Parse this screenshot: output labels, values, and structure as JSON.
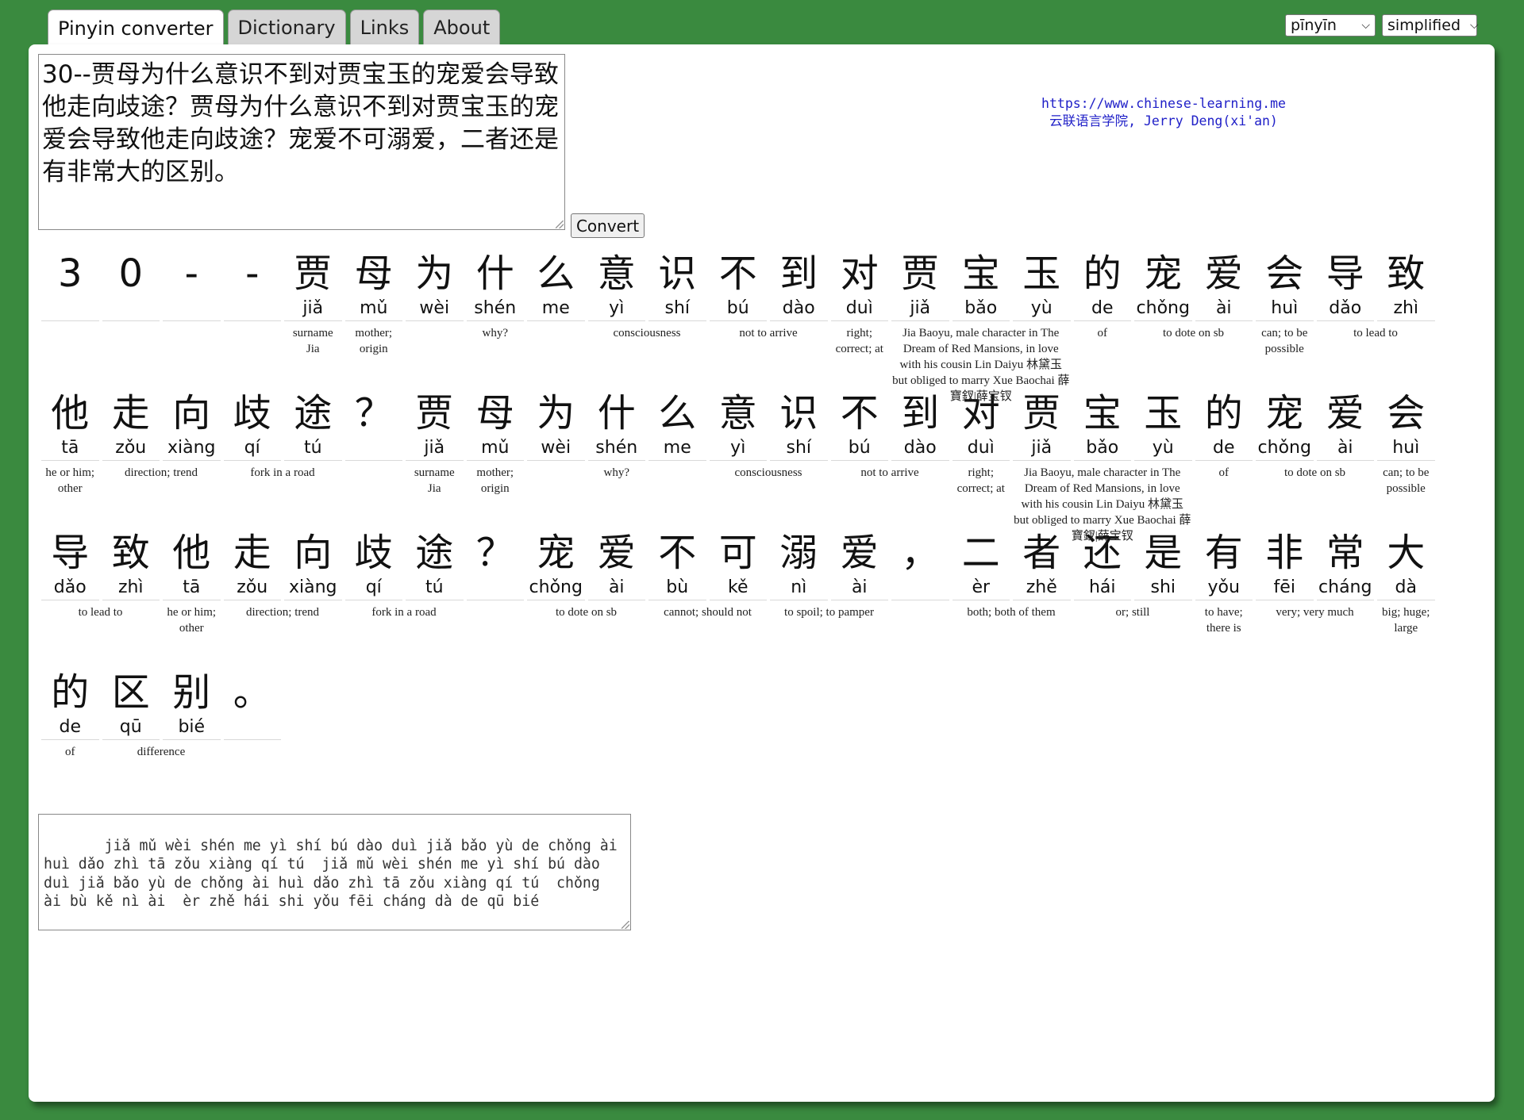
{
  "tabs": [
    "Pinyin converter",
    "Dictionary",
    "Links",
    "About"
  ],
  "selects": {
    "tone_mode": "pīnyīn",
    "script": "simplified"
  },
  "input_text": "30--贾母为什么意识不到对贾宝玉的宠爱会导致他走向歧途？贾母为什么意识不到对贾宝玉的宠爱会导致他走向歧途？宠爱不可溺爱，二者还是有非常大的区别。",
  "convert_label": "Convert",
  "credit": {
    "url": "https://www.chinese-learning.me",
    "line2": "云联语言学院, Jerry Deng(xi'an)"
  },
  "rows": [
    {
      "hanzi": [
        "3",
        "0",
        "-",
        "-",
        "贾",
        "母",
        "为",
        "什",
        "么",
        "意",
        "识",
        "不",
        "到",
        "对",
        "贾",
        "宝",
        "玉",
        "的",
        "宠",
        "爱",
        "会",
        "导",
        "致"
      ],
      "pinyin": [
        "",
        "",
        "",
        "",
        "jiǎ",
        "mǔ",
        "wèi",
        "shén",
        "me",
        "yì",
        "shí",
        "bú",
        "dào",
        "duì",
        "jiǎ",
        "bǎo",
        "yù",
        "de",
        "chǒng",
        "ài",
        "huì",
        "dǎo",
        "zhì"
      ],
      "glosses": [
        {
          "start": 0,
          "span": 1,
          "text": ""
        },
        {
          "start": 1,
          "span": 1,
          "text": ""
        },
        {
          "start": 2,
          "span": 1,
          "text": ""
        },
        {
          "start": 3,
          "span": 1,
          "text": ""
        },
        {
          "start": 4,
          "span": 1,
          "text": "surname Jia"
        },
        {
          "start": 5,
          "span": 1,
          "text": "mother; origin"
        },
        {
          "start": 6,
          "span": 3,
          "text": "why?"
        },
        {
          "start": 9,
          "span": 2,
          "text": "consciousness"
        },
        {
          "start": 11,
          "span": 2,
          "text": "not to arrive"
        },
        {
          "start": 13,
          "span": 1,
          "text": "right; correct; at"
        },
        {
          "start": 14,
          "span": 3,
          "text": "Jia Baoyu, male character in The Dream of Red Mansions, in love with his cousin Lin Daiyu 林黛玉 but obliged to marry Xue Baochai 薛寶釵|薛宝钗"
        },
        {
          "start": 17,
          "span": 1,
          "text": "of"
        },
        {
          "start": 18,
          "span": 2,
          "text": "to dote on sb"
        },
        {
          "start": 20,
          "span": 1,
          "text": "can; to be possible"
        },
        {
          "start": 21,
          "span": 2,
          "text": "to lead to"
        }
      ]
    },
    {
      "hanzi": [
        "他",
        "走",
        "向",
        "歧",
        "途",
        "？",
        "贾",
        "母",
        "为",
        "什",
        "么",
        "意",
        "识",
        "不",
        "到",
        "对",
        "贾",
        "宝",
        "玉",
        "的",
        "宠",
        "爱",
        "会"
      ],
      "pinyin": [
        "tā",
        "zǒu",
        "xiàng",
        "qí",
        "tú",
        "",
        "jiǎ",
        "mǔ",
        "wèi",
        "shén",
        "me",
        "yì",
        "shí",
        "bú",
        "dào",
        "duì",
        "jiǎ",
        "bǎo",
        "yù",
        "de",
        "chǒng",
        "ài",
        "huì"
      ],
      "glosses": [
        {
          "start": 0,
          "span": 1,
          "text": "he or him; other"
        },
        {
          "start": 1,
          "span": 2,
          "text": "direction; trend"
        },
        {
          "start": 3,
          "span": 2,
          "text": "fork in a road"
        },
        {
          "start": 5,
          "span": 1,
          "text": ""
        },
        {
          "start": 6,
          "span": 1,
          "text": "surname Jia"
        },
        {
          "start": 7,
          "span": 1,
          "text": "mother; origin"
        },
        {
          "start": 8,
          "span": 3,
          "text": "why?"
        },
        {
          "start": 11,
          "span": 2,
          "text": "consciousness"
        },
        {
          "start": 13,
          "span": 2,
          "text": "not to arrive"
        },
        {
          "start": 15,
          "span": 1,
          "text": "right; correct; at"
        },
        {
          "start": 16,
          "span": 3,
          "text": "Jia Baoyu, male character in The Dream of Red Mansions, in love with his cousin Lin Daiyu 林黛玉 but obliged to marry Xue Baochai 薛寶釵|薛宝钗"
        },
        {
          "start": 19,
          "span": 1,
          "text": "of"
        },
        {
          "start": 20,
          "span": 2,
          "text": "to dote on sb"
        },
        {
          "start": 22,
          "span": 1,
          "text": "can; to be possible"
        }
      ]
    },
    {
      "hanzi": [
        "导",
        "致",
        "他",
        "走",
        "向",
        "歧",
        "途",
        "？",
        "宠",
        "爱",
        "不",
        "可",
        "溺",
        "爱",
        "，",
        "二",
        "者",
        "还",
        "是",
        "有",
        "非",
        "常",
        "大"
      ],
      "pinyin": [
        "dǎo",
        "zhì",
        "tā",
        "zǒu",
        "xiàng",
        "qí",
        "tú",
        "",
        "chǒng",
        "ài",
        "bù",
        "kě",
        "nì",
        "ài",
        "",
        "èr",
        "zhě",
        "hái",
        "shi",
        "yǒu",
        "fēi",
        "cháng",
        "dà"
      ],
      "glosses": [
        {
          "start": 0,
          "span": 2,
          "text": "to lead to"
        },
        {
          "start": 2,
          "span": 1,
          "text": "he or him; other"
        },
        {
          "start": 3,
          "span": 2,
          "text": "direction; trend"
        },
        {
          "start": 5,
          "span": 2,
          "text": "fork in a road"
        },
        {
          "start": 7,
          "span": 1,
          "text": ""
        },
        {
          "start": 8,
          "span": 2,
          "text": "to dote on sb"
        },
        {
          "start": 10,
          "span": 2,
          "text": "cannot; should not"
        },
        {
          "start": 12,
          "span": 2,
          "text": "to spoil; to pamper"
        },
        {
          "start": 14,
          "span": 1,
          "text": ""
        },
        {
          "start": 15,
          "span": 2,
          "text": "both; both of them"
        },
        {
          "start": 17,
          "span": 2,
          "text": "or; still"
        },
        {
          "start": 19,
          "span": 1,
          "text": "to have; there is"
        },
        {
          "start": 20,
          "span": 2,
          "text": "very; very much"
        },
        {
          "start": 22,
          "span": 1,
          "text": "big; huge; large"
        }
      ]
    },
    {
      "hanzi": [
        "的",
        "区",
        "别",
        "。"
      ],
      "pinyin": [
        "de",
        "qū",
        "bié",
        ""
      ],
      "glosses": [
        {
          "start": 0,
          "span": 1,
          "text": "of"
        },
        {
          "start": 1,
          "span": 2,
          "text": "difference"
        },
        {
          "start": 3,
          "span": 1,
          "text": ""
        }
      ]
    }
  ],
  "output_text": "   jiǎ mǔ wèi shén me yì shí bú dào duì jiǎ bǎo yù de chǒng ài huì dǎo zhì tā zǒu xiàng qí tú  jiǎ mǔ wèi shén me yì shí bú dào duì jiǎ bǎo yù de chǒng ài huì dǎo zhì tā zǒu xiàng qí tú  chǒng ài bù kě nì ài  èr zhě hái shi yǒu fēi cháng dà de qū bié"
}
